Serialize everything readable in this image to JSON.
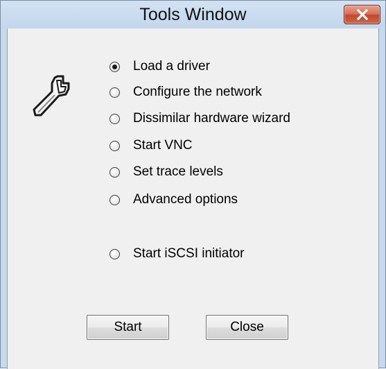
{
  "window": {
    "title": "Tools Window"
  },
  "options": [
    {
      "label": "Load a driver",
      "checked": true
    },
    {
      "label": "Configure the network",
      "checked": false
    },
    {
      "label": "Dissimilar hardware wizard",
      "checked": false
    },
    {
      "label": "Start VNC",
      "checked": false
    },
    {
      "label": "Set trace levels",
      "checked": false
    },
    {
      "label": "Advanced options",
      "checked": false
    },
    {
      "label": "Start iSCSI initiator",
      "checked": false
    }
  ],
  "buttons": {
    "start": "Start",
    "close": "Close"
  },
  "icons": {
    "tool": "wrench-icon",
    "close": "close-icon"
  },
  "colors": {
    "title_bar": "#c9d9ec",
    "close_button": "#c94f35",
    "client_background": "#f0f0f0"
  }
}
